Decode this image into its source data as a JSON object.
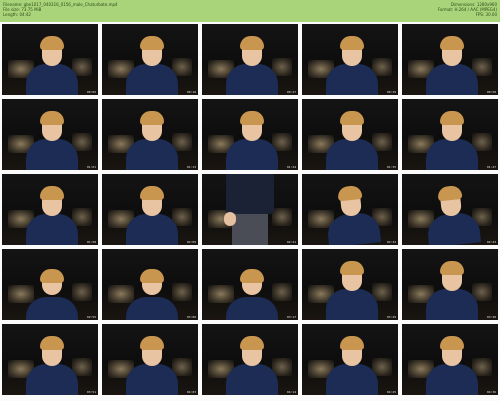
{
  "header": {
    "filename_label": "Filename:",
    "filename_value": "gbe1017_040316_0156_male_Chaturbate.mp4",
    "filesize_label": "File size:",
    "filesize_value": "73.75 MiB",
    "length_label": "Length:",
    "length_value": "04:42",
    "dimensions_label": "Dimensions:",
    "dimensions_value": "1280x960",
    "format_label": "Format:",
    "format_value": "H.264 / AAC (MPEG4)",
    "fps_label": "FPS:",
    "fps_value": "30.00",
    "background_color": "#a9d479"
  },
  "thumbnails": [
    {
      "time": "00:05",
      "pose": "front"
    },
    {
      "time": "00:16",
      "pose": "front"
    },
    {
      "time": "00:27",
      "pose": "front"
    },
    {
      "time": "00:39",
      "pose": "front"
    },
    {
      "time": "00:50",
      "pose": "front"
    },
    {
      "time": "01:01",
      "pose": "front"
    },
    {
      "time": "01:13",
      "pose": "front"
    },
    {
      "time": "01:24",
      "pose": "front"
    },
    {
      "time": "01:35",
      "pose": "front"
    },
    {
      "time": "01:47",
      "pose": "front"
    },
    {
      "time": "01:58",
      "pose": "front"
    },
    {
      "time": "02:09",
      "pose": "front"
    },
    {
      "time": "02:21",
      "pose": "standing"
    },
    {
      "time": "02:32",
      "pose": "tilt"
    },
    {
      "time": "02:43",
      "pose": "tilt"
    },
    {
      "time": "02:55",
      "pose": "low"
    },
    {
      "time": "03:06",
      "pose": "low"
    },
    {
      "time": "03:17",
      "pose": "low"
    },
    {
      "time": "03:29",
      "pose": "front"
    },
    {
      "time": "03:40",
      "pose": "front"
    },
    {
      "time": "03:51",
      "pose": "front"
    },
    {
      "time": "04:03",
      "pose": "front"
    },
    {
      "time": "04:14",
      "pose": "front"
    },
    {
      "time": "04:25",
      "pose": "front"
    },
    {
      "time": "04:36",
      "pose": "front"
    }
  ]
}
